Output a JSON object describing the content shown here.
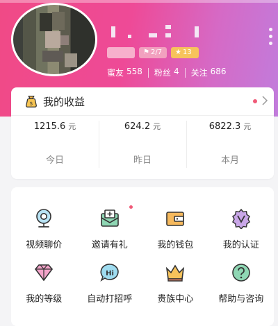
{
  "profile": {
    "badges": [
      {
        "kind": "level",
        "text": ""
      },
      {
        "kind": "rank",
        "icon": "flag-icon",
        "text": "2/7"
      },
      {
        "kind": "stars",
        "icon": "star-icon",
        "text": "13"
      }
    ],
    "stats": [
      {
        "label": "蜜友",
        "value": "558"
      },
      {
        "label": "粉丝",
        "value": "4"
      },
      {
        "label": "关注",
        "value": "686"
      }
    ]
  },
  "earnings": {
    "title": "我的收益",
    "periods": [
      {
        "value": "1215.6",
        "unit": "元",
        "label": "今日"
      },
      {
        "value": "624.2",
        "unit": "元",
        "label": "昨日"
      },
      {
        "value": "6822.3",
        "unit": "元",
        "label": "本月"
      }
    ]
  },
  "menu": {
    "items": [
      {
        "label": "视频聊价",
        "icon": "camera-icon"
      },
      {
        "label": "邀请有礼",
        "icon": "invite-icon",
        "notify": true
      },
      {
        "label": "我的钱包",
        "icon": "wallet-icon"
      },
      {
        "label": "我的认证",
        "icon": "verify-icon"
      },
      {
        "label": "我的等级",
        "icon": "diamond-icon"
      },
      {
        "label": "自动打招呼",
        "icon": "hi-icon"
      },
      {
        "label": "贵族中心",
        "icon": "crown-icon"
      },
      {
        "label": "帮助与咨询",
        "icon": "help-icon"
      }
    ]
  },
  "colors": {
    "header_start": "#f04a86",
    "header_end": "#c17cdc",
    "accent": "#f05a78"
  }
}
